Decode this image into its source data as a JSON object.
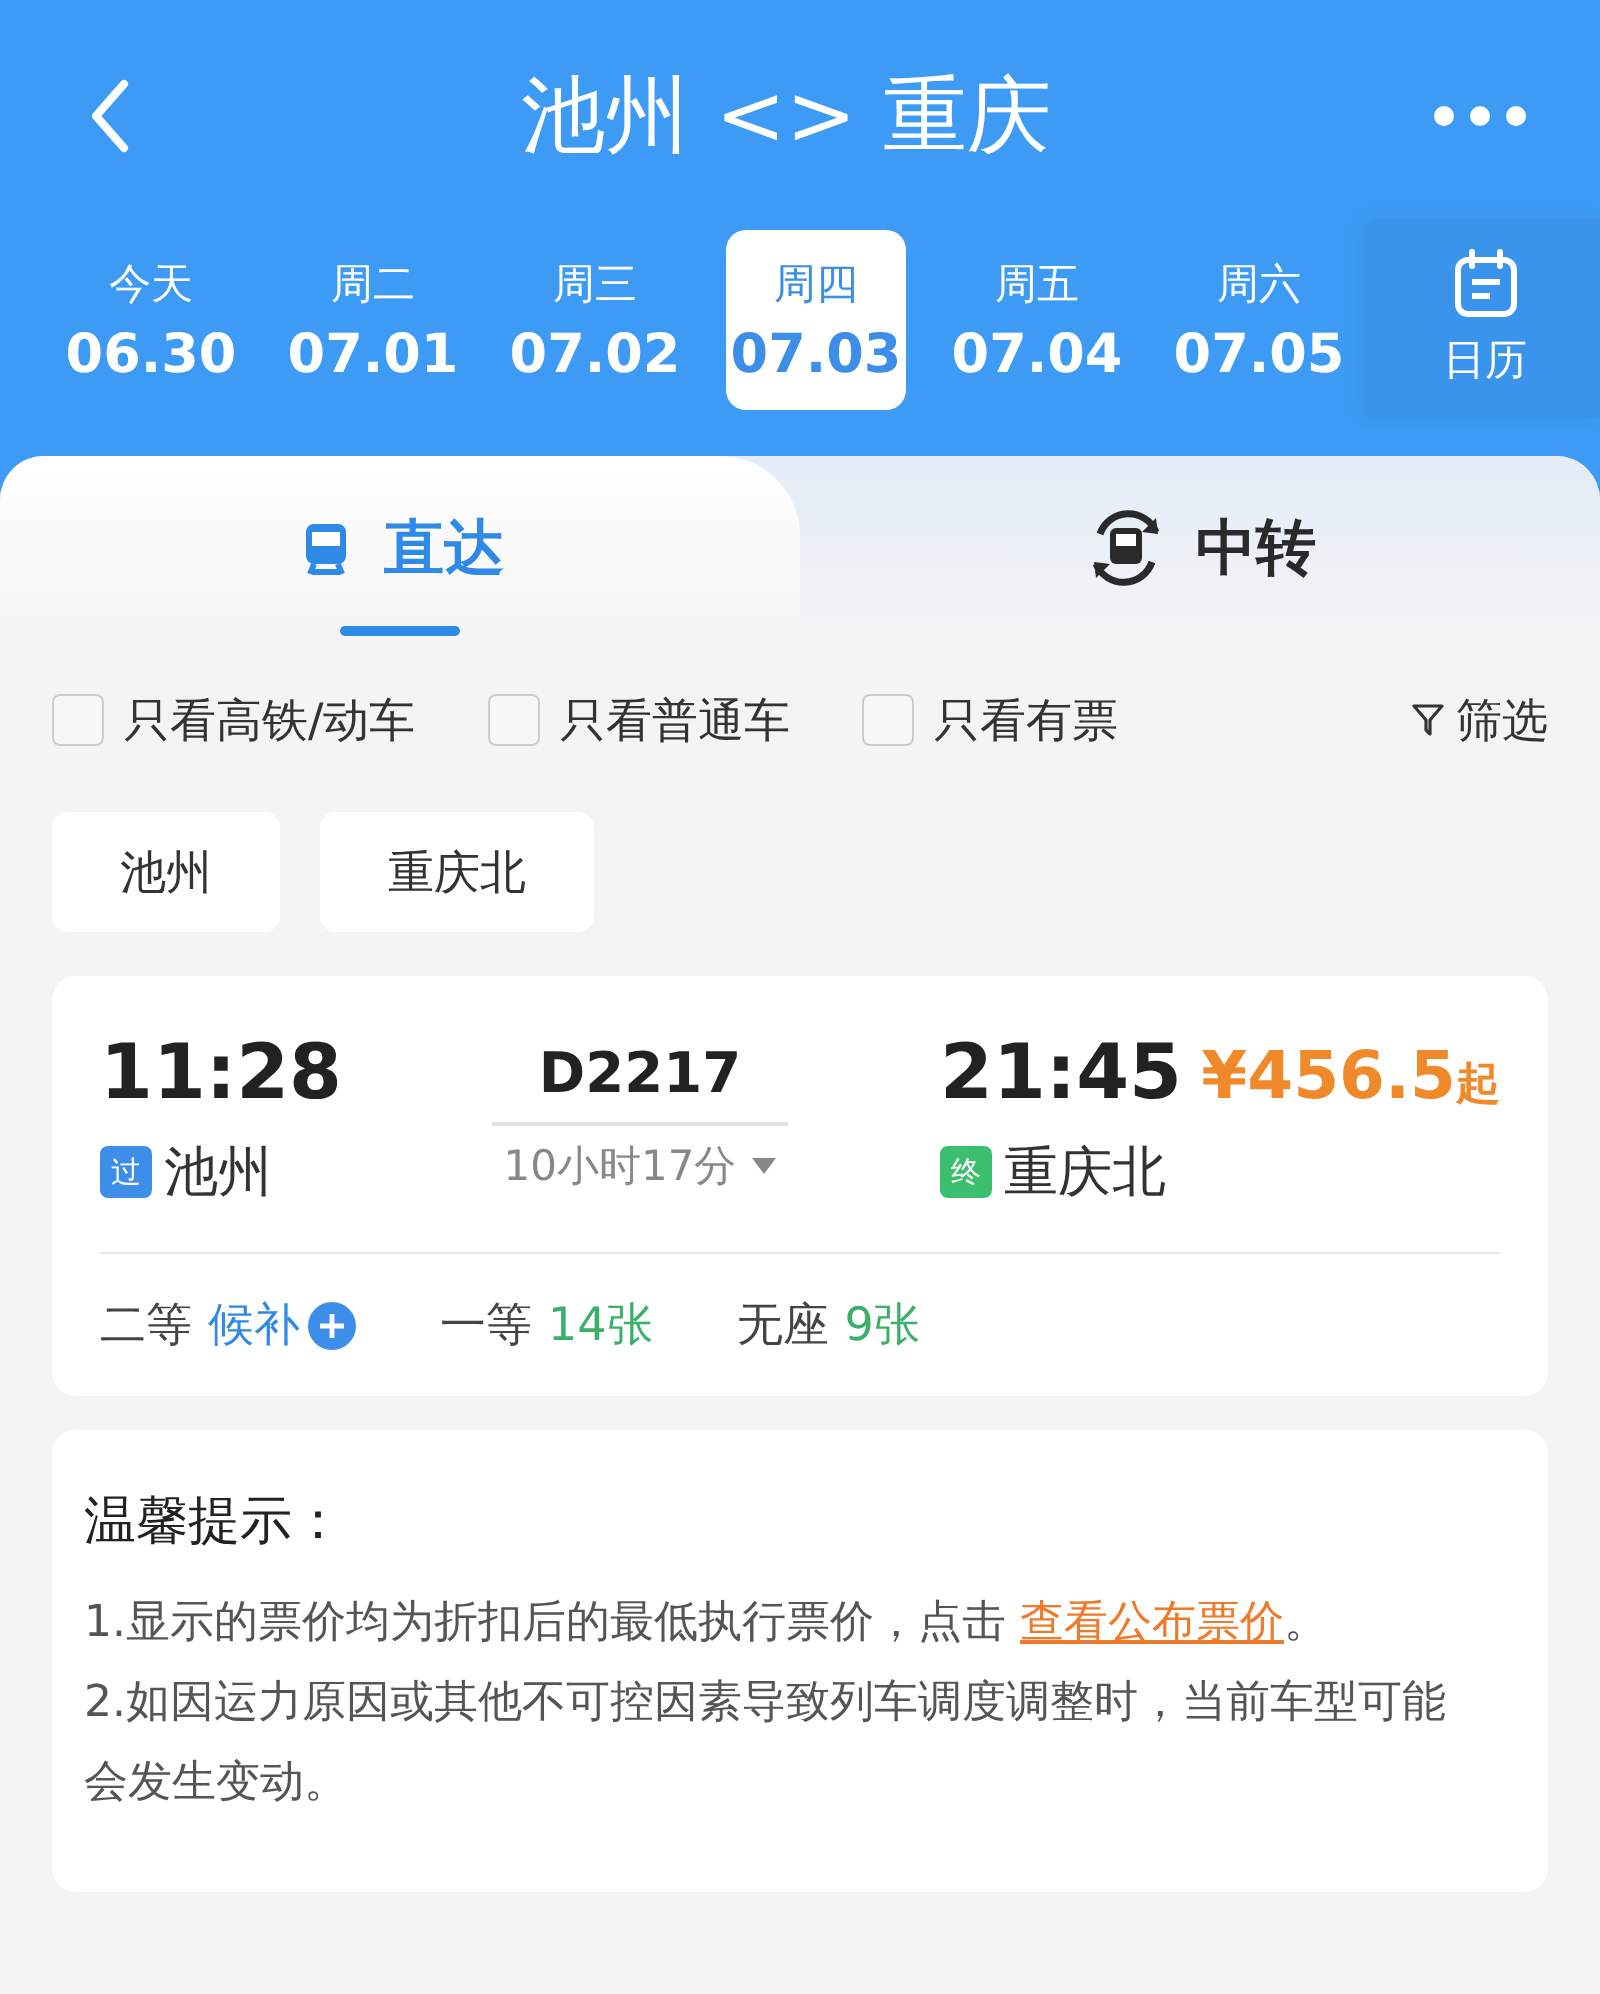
{
  "header": {
    "title": "池州 <> 重庆"
  },
  "dates": [
    {
      "weekday": "今天",
      "date": "06.30",
      "selected": false
    },
    {
      "weekday": "周二",
      "date": "07.01",
      "selected": false
    },
    {
      "weekday": "周三",
      "date": "07.02",
      "selected": false
    },
    {
      "weekday": "周四",
      "date": "07.03",
      "selected": true
    },
    {
      "weekday": "周五",
      "date": "07.04",
      "selected": false
    },
    {
      "weekday": "周六",
      "date": "07.05",
      "selected": false
    }
  ],
  "calendar": {
    "label": "日历"
  },
  "tabs": [
    {
      "label": "直达",
      "selected": true,
      "kind": "direct"
    },
    {
      "label": "中转",
      "selected": false,
      "kind": "transfer"
    }
  ],
  "filters": [
    {
      "label": "只看高铁/动车",
      "checked": false
    },
    {
      "label": "只看普通车",
      "checked": false
    },
    {
      "label": "只看有票",
      "checked": false
    }
  ],
  "filter_button": {
    "label": "筛选"
  },
  "stations": [
    "池州",
    "重庆北"
  ],
  "train": {
    "depart_time": "11:28",
    "number": "D2217",
    "arrive_time": "21:45",
    "price": "¥456.5",
    "price_suffix": "起",
    "from": {
      "tag": "过",
      "color": "#3d8ee8",
      "name": "池州"
    },
    "to": {
      "tag": "终",
      "color": "#3bbf6e",
      "name": "重庆北"
    },
    "duration": "10小时17分",
    "seats": [
      {
        "class": "二等",
        "status": "候补",
        "kind": "waitlist"
      },
      {
        "class": "一等",
        "status": "14张",
        "kind": "count"
      },
      {
        "class": "无座",
        "status": "9张",
        "kind": "count"
      }
    ]
  },
  "notice": {
    "title": "温馨提示：",
    "lines": [
      {
        "text": "1.显示的票价均为折扣后的最低执行票价，点击 ",
        "link": "查看公布票价",
        "after": "。"
      },
      {
        "text": "2.如因运力原因或其他不可控因素导致列车调度调整时，当前车型可能会发生变动。"
      }
    ]
  }
}
